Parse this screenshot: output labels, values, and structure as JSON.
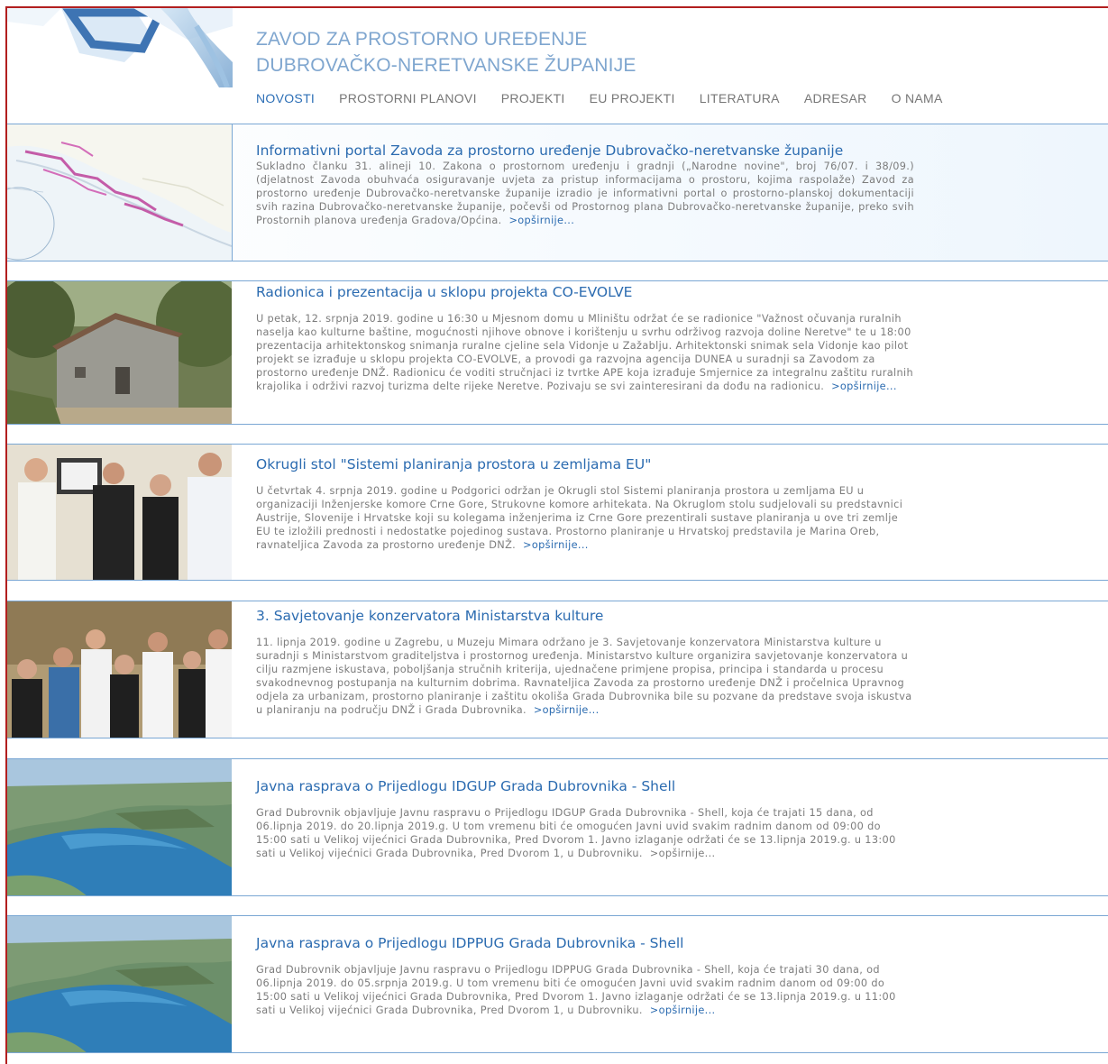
{
  "site": {
    "title_line1": "ZAVOD ZA PROSTORNO UREĐENJE",
    "title_line2": "DUBROVAČKO-NERETVANSKE ŽUPANIJE"
  },
  "nav": [
    {
      "label": "NOVOSTI",
      "active": true
    },
    {
      "label": "PROSTORNI PLANOVI"
    },
    {
      "label": "PROJEKTI"
    },
    {
      "label": "EU PROJEKTI"
    },
    {
      "label": "LITERATURA"
    },
    {
      "label": "ADRESAR"
    },
    {
      "label": "O NAMA"
    }
  ],
  "news": [
    {
      "title": "Informativni portal Zavoda za prostorno uređenje Dubrovačko-neretvanske županije",
      "text": "Sukladno članku 31. alineji 10. Zakona o prostornom uređenju i gradnji („Narodne novine\", broj 76/07. i 38/09.) (djelatnost Zavoda obuhvaća osiguravanje uvjeta za pristup informacijama o prostoru, kojima raspolaže) Zavod za prostorno uređenje Dubrovačko-neretvanske županije izradio je informativni portal o prostorno-planskoj dokumentaciji svih razina Dubrovačko-neretvanske županije, počevši od Prostornog plana Dubrovačko-neretvanske županije, preko svih Prostornih planova uređenja Gradova/Općina.",
      "more": ">opširnije..."
    },
    {
      "title": "Radionica i prezentacija u sklopu projekta CO-EVOLVE",
      "text": "U petak, 12. srpnja 2019. godine u 16:30 u Mjesnom domu u Mliništu održat će se radionice \"Važnost očuvanja ruralnih naselja kao kulturne baštine, mogućnosti njihove obnove i korištenju u svrhu održivog razvoja doline Neretve\" te u 18:00 prezentacija arhitektonskog snimanja ruralne cjeline sela Vidonje u Zažablju. Arhitektonski snimak sela Vidonje kao pilot projekt se izrađuje u sklopu projekta CO-EVOLVE, a provodi ga razvojna agencija DUNEA u suradnji sa Zavodom za prostorno uređenje DNŽ. Radionicu će voditi stručnjaci iz tvrtke APE koja izrađuje Smjernice za integralnu zaštitu ruralnih krajolika i održivi razvoj turizma delte rijeke Neretve. Pozivaju se svi zainteresirani da dođu na radionicu.",
      "more": ">opširnije..."
    },
    {
      "title": "Okrugli stol \"Sistemi planiranja prostora u zemljama EU\"",
      "text": "U četvrtak 4. srpnja 2019. godine u Podgorici održan je Okrugli stol Sistemi planiranja prostora u zemljama EU u organizaciji Inženjerske komore Crne Gore, Strukovne komore arhitekata. Na Okruglom stolu sudjelovali su predstavnici Austrije, Slovenije i Hrvatske koji su kolegama inženjerima iz Crne Gore prezentirali sustave planiranja u ove tri zemlje EU te izložili prednosti i nedostatke pojedinog sustava. Prostorno planiranje u Hrvatskoj predstavila je Marina Oreb, ravnateljica Zavoda za prostorno uređenje DNŽ.",
      "more": ">opširnije..."
    },
    {
      "title": "3. Savjetovanje konzervatora Ministarstva kulture",
      "text": "11. lipnja 2019. godine u Zagrebu, u Muzeju Mimara održano je 3. Savjetovanje konzervatora Ministarstva kulture u suradnji s Ministarstvom graditeljstva i prostornog uređenja. Ministarstvo kulture organizira savjetovanje konzervatora u cilju razmjene iskustava, poboljšanja stručnih kriterija, ujednačene primjene propisa, principa i standarda u procesu svakodnevnog postupanja na kulturnim dobrima. Ravnateljica Zavoda za prostorno uređenje DNŽ i pročelnica Upravnog odjela za urbanizam, prostorno planiranje i zaštitu okoliša Grada Dubrovnika bile su pozvane da predstave svoja iskustva u planiranju na području DNŽ i Grada Dubrovnika.",
      "more": ">opširnije..."
    },
    {
      "title": "Javna rasprava o Prijedlogu IDGUP Grada Dubrovnika - Shell",
      "text": "Grad Dubrovnik objavljuje Javnu raspravu o Prijedlogu IDGUP Grada Dubrovnika - Shell, koja će trajati 15 dana, od 06.lipnja 2019. do 20.lipnja 2019.g. U tom vremenu biti će omogućen Javni uvid svakim radnim danom od 09:00 do 15:00 sati u Velikoj vijećnici Grada Dubrovnika, Pred Dvorom 1. Javno izlaganje održati će se 13.lipnja 2019.g. u 13:00 sati u Velikoj vijećnici Grada Dubrovnika, Pred Dvorom 1, u Dubrovniku.",
      "more": ">opširnije..."
    },
    {
      "title": "Javna rasprava o Prijedlogu IDPPUG Grada Dubrovnika - Shell",
      "text": "Grad Dubrovnik objavljuje Javnu raspravu o Prijedlogu IDPPUG Grada Dubrovnika - Shell, koja će trajati 30 dana, od 06.lipnja 2019. do 05.srpnja 2019.g. U tom vremenu biti će omogućen Javni uvid svakim radnim danom od 09:00 do 15:00 sati u Velikoj vijećnici Grada Dubrovnika, Pred Dvorom 1. Javno izlaganje održati će se 13.lipnja 2019.g. u 11:00 sati u Velikoj vijećnici Grada Dubrovnika, Pred Dvorom 1, u Dubrovniku.",
      "more": ">opširnije..."
    }
  ]
}
